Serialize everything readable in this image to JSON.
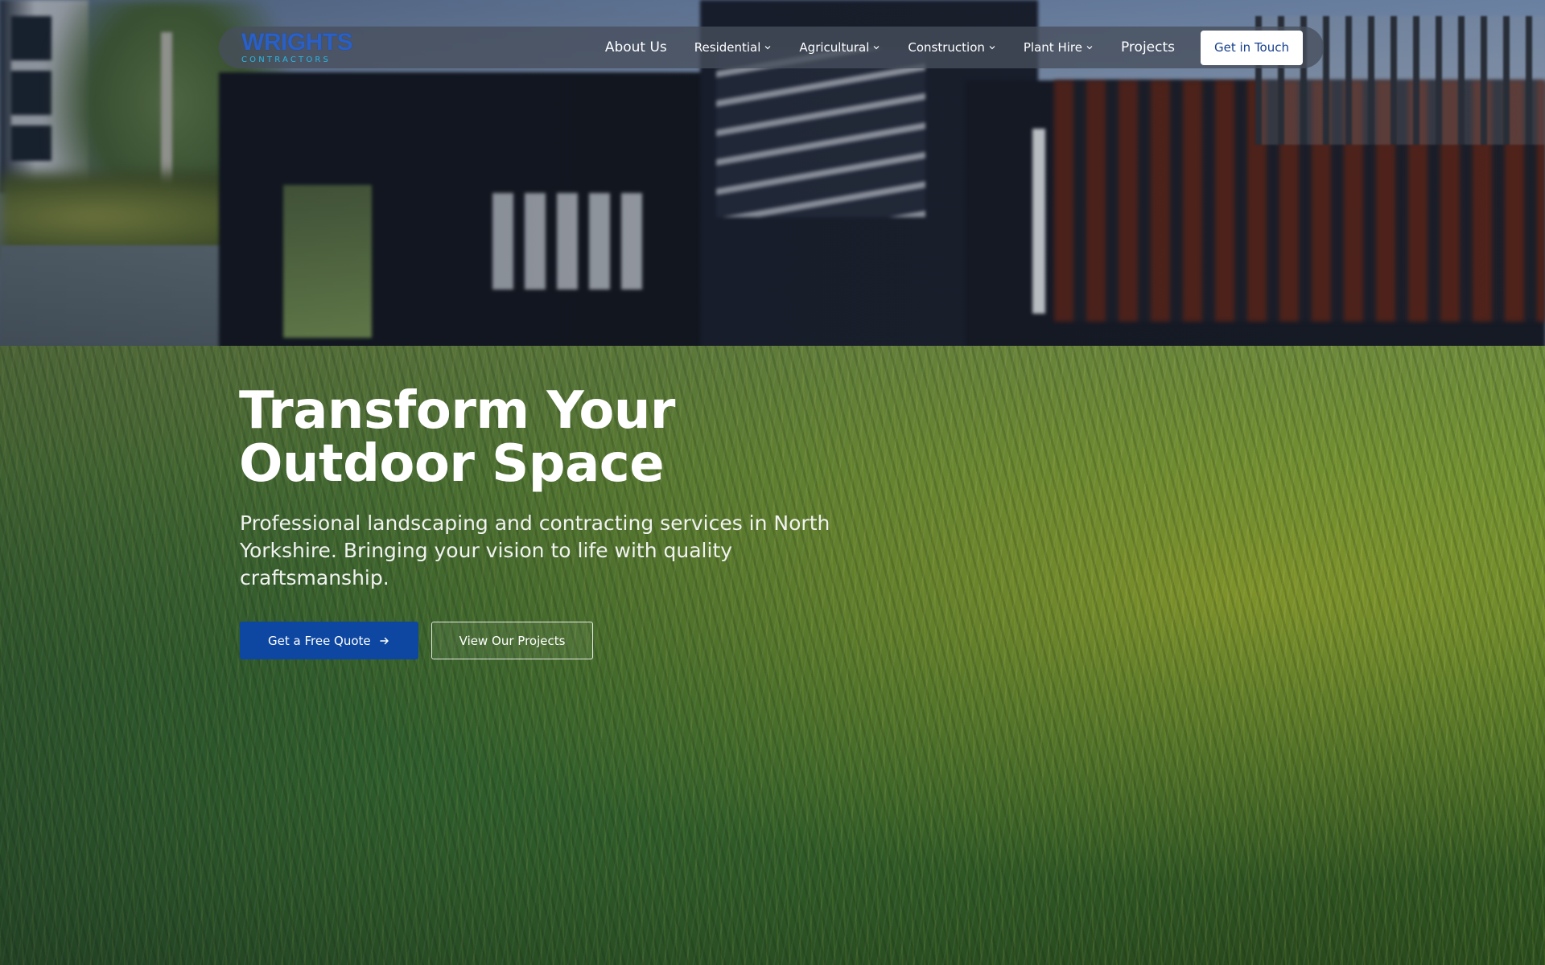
{
  "brand": {
    "logo_main": "WRIGHTS",
    "logo_sub": "CONTRACTORS",
    "primary_color": "#0d47a1",
    "accent_color": "#2ab7e6"
  },
  "nav": {
    "items": [
      {
        "label": "About Us",
        "dropdown": false
      },
      {
        "label": "Residential",
        "dropdown": true
      },
      {
        "label": "Agricultural",
        "dropdown": true
      },
      {
        "label": "Construction",
        "dropdown": true
      },
      {
        "label": "Plant Hire",
        "dropdown": true
      },
      {
        "label": "Projects",
        "dropdown": false
      }
    ],
    "cta_label": "Get in Touch"
  },
  "hero": {
    "title_line1": "Transform Your",
    "title_line2": "Outdoor Space",
    "subtitle": "Professional landscaping and contracting services in North Yorkshire. Bringing your vision to life with quality craftsmanship.",
    "primary_button": "Get a Free Quote",
    "secondary_button": "View Our Projects",
    "background_image": "lawn-grass-photo"
  },
  "icons": {
    "dropdown": "chevron-down-icon",
    "arrow": "arrow-right-icon"
  }
}
